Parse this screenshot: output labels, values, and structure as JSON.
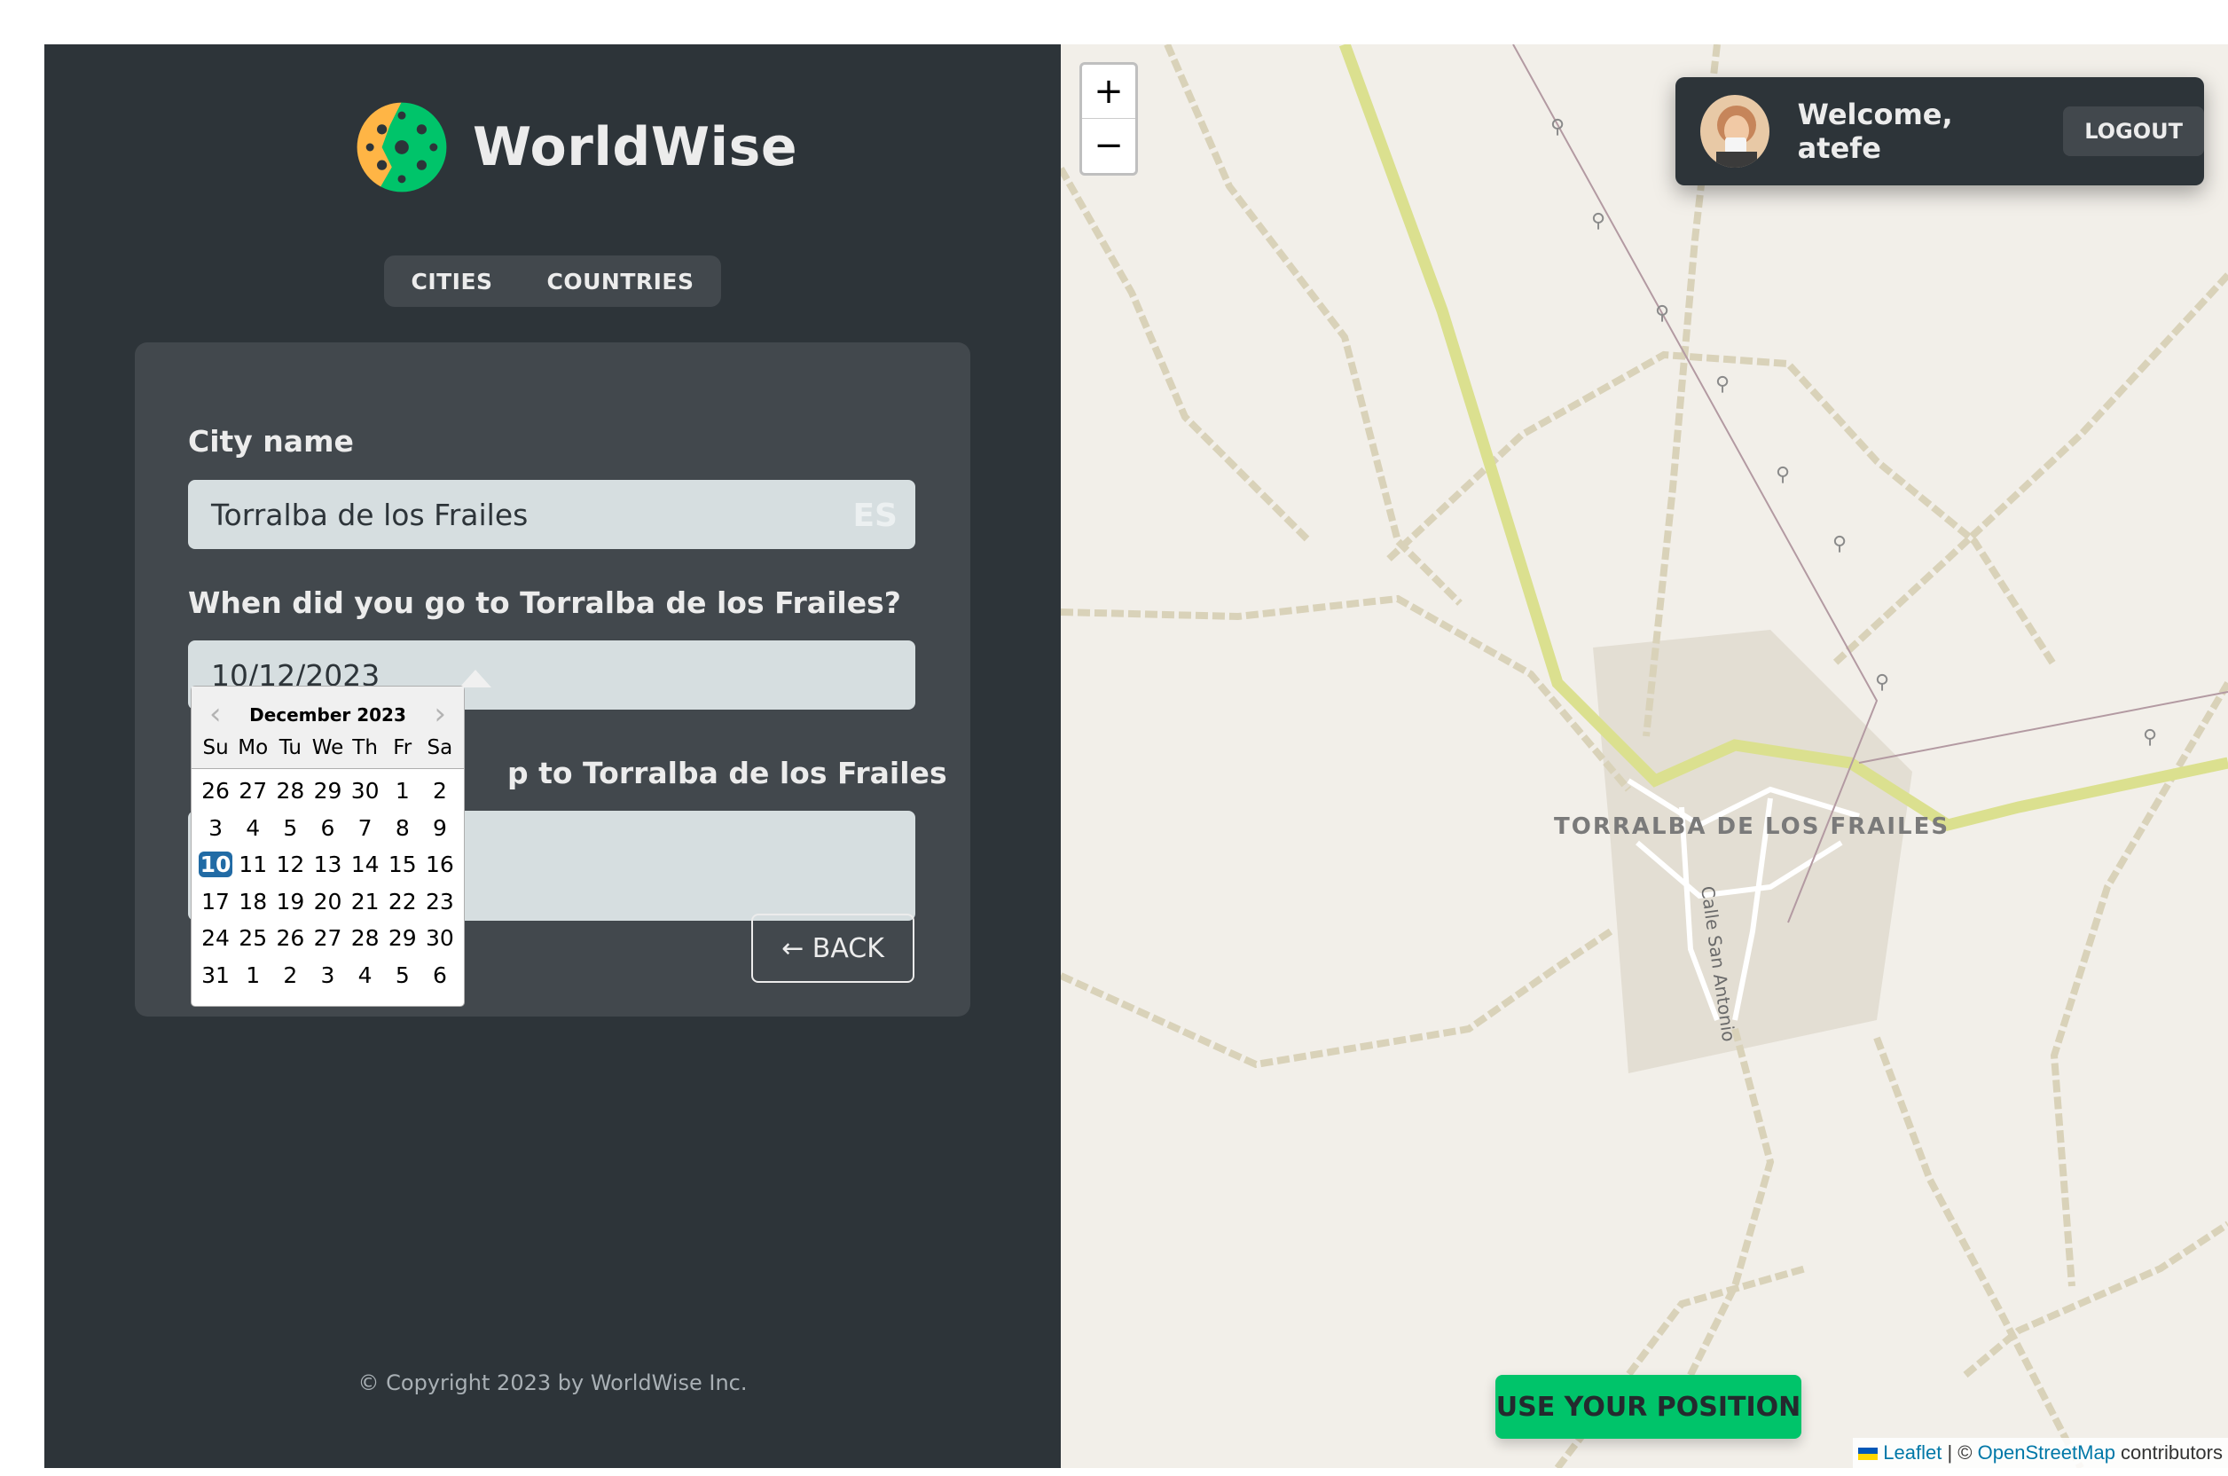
{
  "app": {
    "name": "WorldWise"
  },
  "nav": {
    "tabs": [
      {
        "label": "CITIES"
      },
      {
        "label": "COUNTRIES"
      }
    ]
  },
  "form": {
    "city_label": "City name",
    "city_value": "Torralba de los Frailes",
    "country_code": "ES",
    "date_label": "When did you go to Torralba de los Frailes?",
    "date_value": "10/12/2023",
    "notes_label_visible": "p to Torralba de los Frailes",
    "notes_value": "",
    "back_button": "← BACK"
  },
  "datepicker": {
    "month": "December 2023",
    "weekdays": [
      "Su",
      "Mo",
      "Tu",
      "We",
      "Th",
      "Fr",
      "Sa"
    ],
    "weeks": [
      [
        "26",
        "27",
        "28",
        "29",
        "30",
        "1",
        "2"
      ],
      [
        "3",
        "4",
        "5",
        "6",
        "7",
        "8",
        "9"
      ],
      [
        "10",
        "11",
        "12",
        "13",
        "14",
        "15",
        "16"
      ],
      [
        "17",
        "18",
        "19",
        "20",
        "21",
        "22",
        "23"
      ],
      [
        "24",
        "25",
        "26",
        "27",
        "28",
        "29",
        "30"
      ],
      [
        "31",
        "1",
        "2",
        "3",
        "4",
        "5",
        "6"
      ]
    ],
    "selected": "10",
    "prev_icon": "chevron-left-icon",
    "next_icon": "chevron-right-icon"
  },
  "footer": {
    "copyright": "© Copyright 2023 by WorldWise Inc."
  },
  "map": {
    "zoom_in": "+",
    "zoom_out": "−",
    "place_label": "TORRALBA DE LOS FRAILES",
    "street_label": "Calle San Antonio",
    "use_position": "USE YOUR POSITION",
    "attribution": {
      "leaflet": "Leaflet",
      "separator": " | © ",
      "osm": "OpenStreetMap",
      "suffix": " contributors"
    }
  },
  "user": {
    "welcome": "Welcome, atefe",
    "logout": "LOGOUT"
  },
  "colors": {
    "sidebar_bg": "#2d3439",
    "panel_bg": "#42484d",
    "brand_green": "#00c46a",
    "brand_yellow": "#ffb545",
    "map_bg": "#f2efe9"
  }
}
